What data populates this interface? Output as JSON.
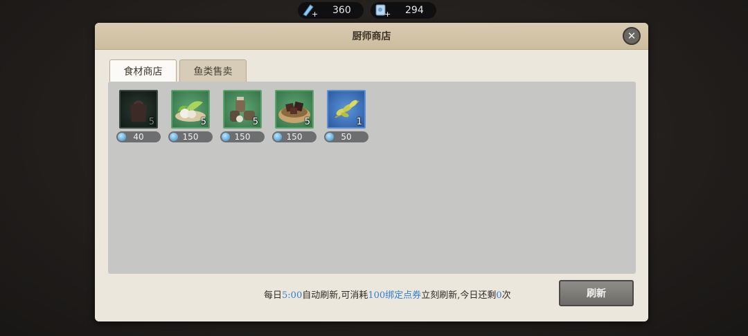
{
  "currencies": [
    {
      "icon": "blue-gem-icon",
      "value": "360"
    },
    {
      "icon": "scroll-gem-icon",
      "value": "294"
    }
  ],
  "panel": {
    "title": "厨师商店",
    "close_icon": "close-icon",
    "tabs": [
      {
        "label": "食材商店",
        "active": true
      },
      {
        "label": "鱼类售卖",
        "active": false
      }
    ]
  },
  "items": [
    {
      "name": "dark-sack",
      "icon": "sack-icon",
      "quantity": "5",
      "price": "40",
      "rarity": "dark"
    },
    {
      "name": "vegetables",
      "icon": "vegetables-icon",
      "quantity": "5",
      "price": "150",
      "rarity": "green"
    },
    {
      "name": "spice-jars",
      "icon": "spice-jars-icon",
      "quantity": "5",
      "price": "150",
      "rarity": "green"
    },
    {
      "name": "meat-bowl",
      "icon": "meat-bowl-icon",
      "quantity": "5",
      "price": "150",
      "rarity": "green"
    },
    {
      "name": "herb-sprig",
      "icon": "herb-icon",
      "quantity": "1",
      "price": "50",
      "rarity": "blue"
    }
  ],
  "footer": {
    "part1": "每日",
    "time": "5:00",
    "part2": "自动刷新,可消耗",
    "cost": "100绑定点券",
    "part3": "立刻刷新,今日还剩",
    "remaining": "0",
    "part4": "次",
    "refresh_label": "刷新"
  }
}
